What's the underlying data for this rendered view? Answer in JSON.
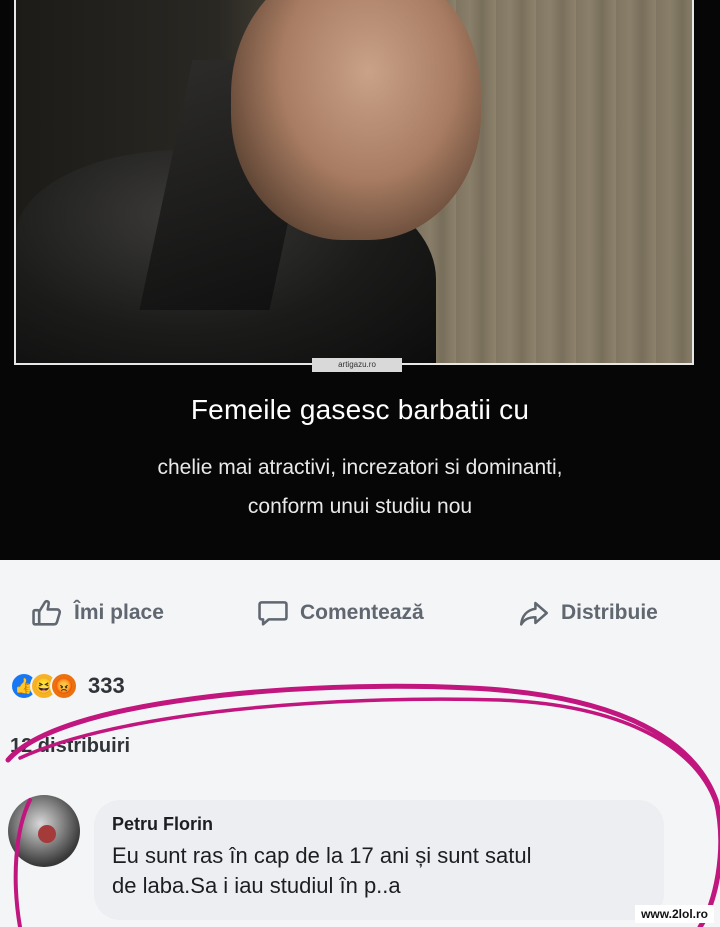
{
  "meme": {
    "image_credit": "artigazu.ro",
    "caption_main": "Femeile gasesc barbatii cu",
    "caption_line1": "chelie mai atractivi, increzatori si dominanti,",
    "caption_line2": "conform unui studiu nou"
  },
  "actions": {
    "like_label": "Îmi place",
    "comment_label": "Comentează",
    "share_label": "Distribuie"
  },
  "reactions": {
    "icons": [
      "like-icon",
      "haha-icon",
      "angry-icon"
    ],
    "count": "333"
  },
  "shares_text": "12 distribuiri",
  "comment": {
    "author": "Petru Florin",
    "line1": "Eu sunt ras în cap de la 17 ani și sunt satul",
    "line2": "de laba.Sa i  iau studiul în p..a"
  },
  "watermark": "www.2lol.ro",
  "colors": {
    "scribble": "#c1167e",
    "facebook_blue": "#1877f2",
    "action_gray": "#606770"
  }
}
